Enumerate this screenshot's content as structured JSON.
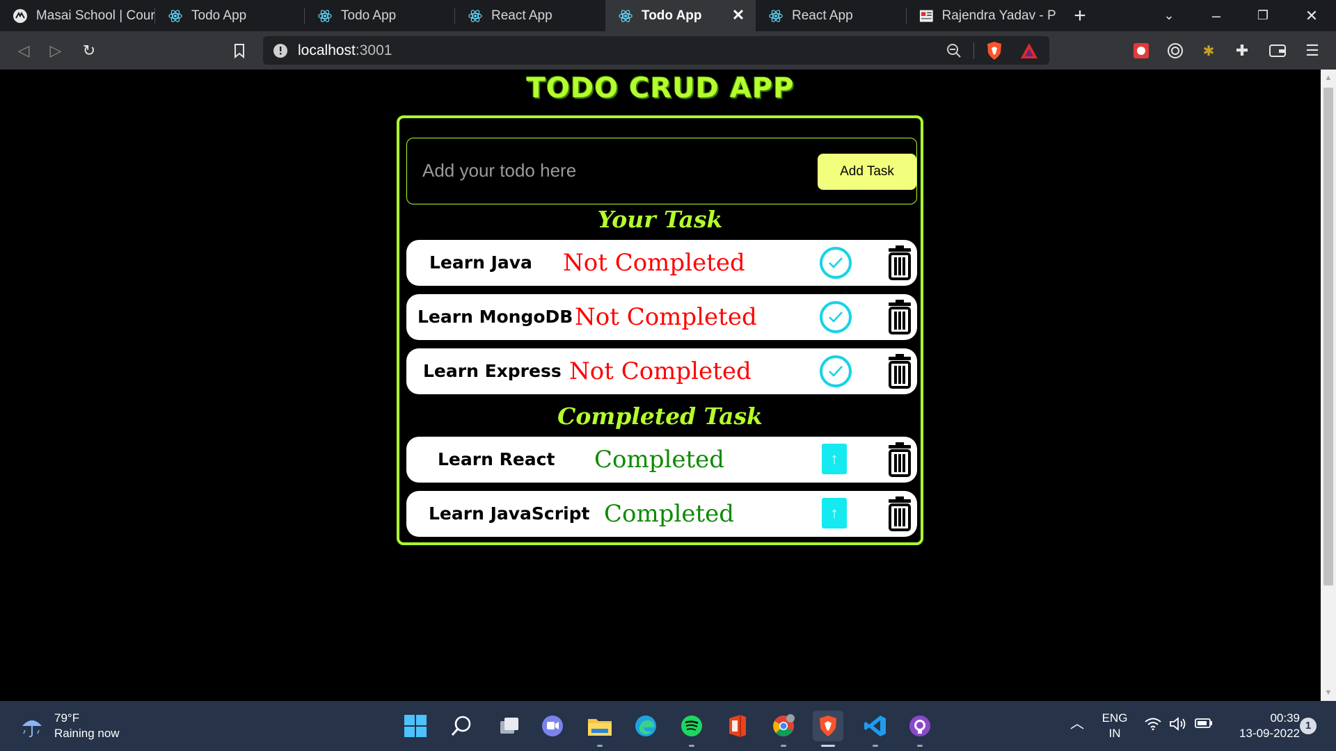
{
  "browser": {
    "tabs": [
      {
        "title": "Masai School | Cour",
        "icon": "masai-icon",
        "active": false
      },
      {
        "title": "Todo App",
        "icon": "react-icon",
        "active": false
      },
      {
        "title": "Todo App",
        "icon": "react-icon",
        "active": false
      },
      {
        "title": "React App",
        "icon": "react-icon",
        "active": false
      },
      {
        "title": "Todo App",
        "icon": "react-icon",
        "active": true
      },
      {
        "title": "React App",
        "icon": "react-icon",
        "active": false
      },
      {
        "title": "Rajendra Yadav - Po",
        "icon": "portfolio-icon",
        "active": false
      }
    ],
    "new_tab_symbol": "+",
    "url_host": "localhost",
    "url_port": ":3001"
  },
  "app": {
    "title": "TODO CRUD APP",
    "input_placeholder": "Add your todo here",
    "add_button_label": "Add Task",
    "pending_section_title": "Your Task",
    "completed_section_title": "Completed Task",
    "pending_tasks": [
      {
        "name": "Learn Java",
        "status": "Not Completed"
      },
      {
        "name": "Learn MongoDB",
        "status": "Not Completed"
      },
      {
        "name": "Learn Express",
        "status": "Not Completed"
      }
    ],
    "completed_tasks": [
      {
        "name": "Learn React",
        "status": "Completed"
      },
      {
        "name": "Learn JavaScript",
        "status": "Completed"
      }
    ],
    "colors": {
      "accent": "#adff2f",
      "pending": "#ff0000",
      "done": "#0d8a00",
      "check": "#17d4e6",
      "add_button": "#f1ff7d"
    }
  },
  "taskbar": {
    "weather_temp": "79°F",
    "weather_desc": "Raining now",
    "lang_top": "ENG",
    "lang_bottom": "IN",
    "time": "00:39",
    "date": "13-09-2022",
    "notification_count": "1"
  }
}
